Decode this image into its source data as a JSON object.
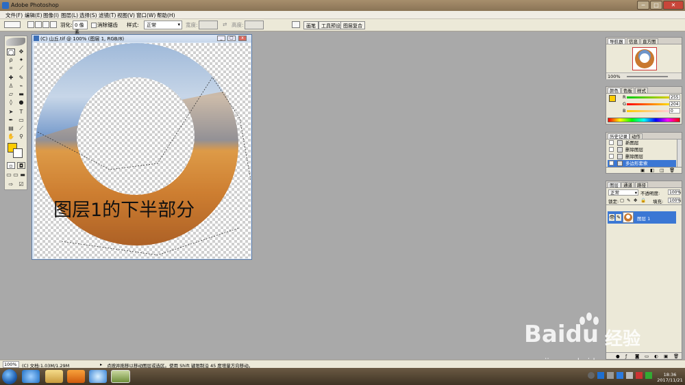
{
  "window": {
    "title": "Adobe Photoshop",
    "controls": {
      "minimize": "─",
      "maximize": "□",
      "close": "✕"
    }
  },
  "menu": [
    "文件(F)",
    "编辑(E)",
    "图像(I)",
    "图层(L)",
    "选择(S)",
    "滤镜(T)",
    "视图(V)",
    "窗口(W)",
    "帮助(H)"
  ],
  "options_bar": {
    "feather_label": "羽化:",
    "feather_value": "0 像素",
    "antialias_label": "消除锯齿",
    "style_label": "样式:",
    "style_value": "正常",
    "width_label": "宽度:",
    "height_label": "高度:",
    "wells": [
      "画笔",
      "工具预设",
      "图层复合"
    ]
  },
  "document": {
    "title": "(C) 山丘.tif @ 100% (图层 1, RGB/8)",
    "canvas_text": "图层1的下半部分"
  },
  "panels": {
    "navigator": {
      "tabs": [
        "导航器",
        "信息",
        "直方图"
      ],
      "zoom": "100%"
    },
    "color": {
      "tabs": [
        "颜色",
        "色板",
        "样式"
      ],
      "channels": [
        {
          "label": "R",
          "value": "255",
          "fraction": 1.0
        },
        {
          "label": "G",
          "value": "204",
          "fraction": 0.8
        },
        {
          "label": "B",
          "value": "0",
          "fraction": 0.0
        }
      ],
      "foreground": "#ffcc00"
    },
    "history": {
      "tabs": [
        "历史记录",
        "动作"
      ],
      "items": [
        "新图层",
        "删除图层",
        "删除图层",
        "多边形套索"
      ],
      "selected_index": 3
    },
    "layers": {
      "tabs": [
        "图层",
        "通道",
        "路径"
      ],
      "blend_mode": "正常",
      "opacity_label": "不透明度:",
      "opacity_value": "100%",
      "lock_label": "锁定:",
      "fill_label": "填充:",
      "fill_value": "100%",
      "layer_name": "图层 1"
    }
  },
  "status": {
    "zoom": "100%",
    "doc_info": "(C) 文档:1.03M/1.29M",
    "hint": "点按并拖移以移动图层或选区。使用 Shift 键限制沿 45 度增量方向移动。"
  },
  "taskbar": {
    "time": "18:36",
    "date": "2017/11/21"
  },
  "watermark": {
    "brand": "Bai",
    "brand2": "du",
    "cn": "经验",
    "url": "jingyan.baidu.com"
  }
}
